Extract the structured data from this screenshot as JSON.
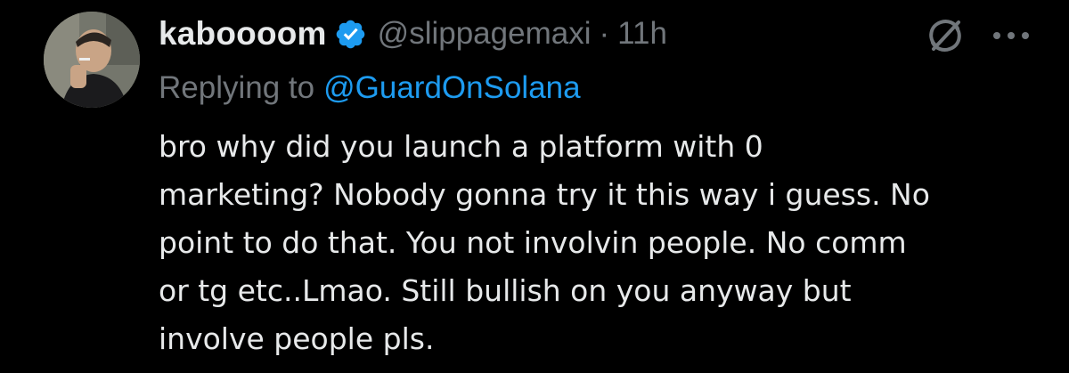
{
  "colors": {
    "background": "#000000",
    "primary_text": "#e7e9ea",
    "secondary_text": "#71767b",
    "accent": "#1d9bf0"
  },
  "tweet": {
    "author": {
      "display_name": "kaboooom",
      "verified": true,
      "verified_icon": "verified-badge-icon",
      "handle": "@slippagemaxi",
      "separator": "·",
      "timestamp": "11h",
      "avatar": "avatar"
    },
    "actions": {
      "grok_icon": "grok-icon",
      "more_icon": "more-options-icon"
    },
    "reply": {
      "prefix": "Replying to",
      "mention": "@GuardOnSolana"
    },
    "text_lines": [
      "bro why did you launch a platform with 0",
      "marketing? Nobody gonna try it this way i guess. No",
      "point to do that. You not involvin people. No comm",
      "or tg etc..Lmao. Still bullish on you anyway but",
      "involve people pls."
    ]
  }
}
